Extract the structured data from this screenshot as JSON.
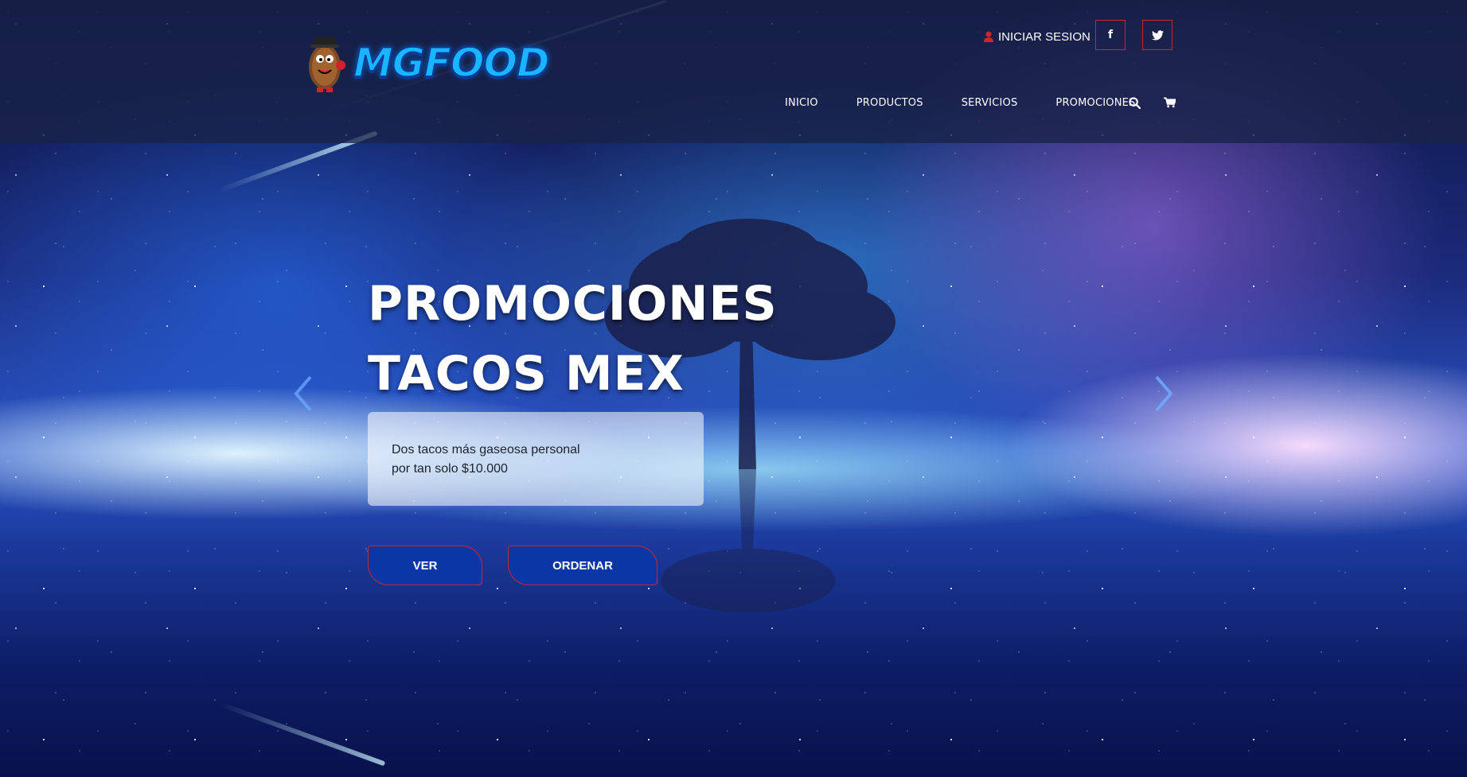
{
  "header": {
    "brand": "MGFOOD",
    "login_label": "INICIAR SESION",
    "social": [
      {
        "name": "facebook",
        "icon": "facebook-icon",
        "glyph": "f"
      },
      {
        "name": "twitter",
        "icon": "twitter-icon"
      }
    ],
    "nav": [
      {
        "label": "INICIO"
      },
      {
        "label": "PRODUCTOS"
      },
      {
        "label": "SERVICIOS"
      },
      {
        "label": "PROMOCIONES"
      }
    ],
    "icons": [
      "search-icon",
      "cart-icon"
    ]
  },
  "hero": {
    "title_line1": "PROMOCIONES",
    "title_line2": "TACOS MEX",
    "description": "Dos tacos más gaseosa personal por tan solo $10.000",
    "buttons": {
      "ver": "VER",
      "ordenar": "ORDENAR"
    },
    "arrows": [
      "chevron-left-icon",
      "chevron-right-icon"
    ]
  },
  "colors": {
    "header_bg": "#182248",
    "accent_red": "#d2232a",
    "button_blue": "#0b36a6",
    "logo_blue": "#19b5ff"
  }
}
